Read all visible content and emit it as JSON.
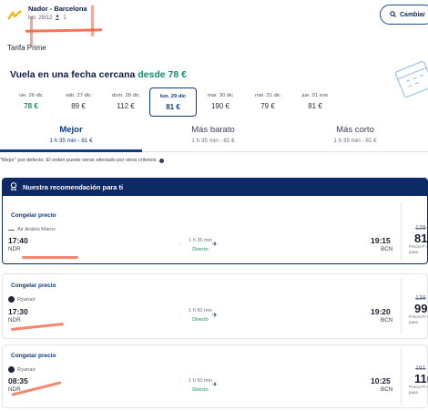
{
  "header": {
    "route": "Nador - Barcelona",
    "date": "lun. 29/12",
    "passengers": "1",
    "change_label": "Cambiar"
  },
  "fare": "Tarifa Prime",
  "nearby": {
    "title": "Vuela en una fecha cercana",
    "from_label": "desde 78 €",
    "dates": [
      {
        "day": "vie. 26 dic",
        "price": "78 €",
        "highlight": true,
        "selected": false
      },
      {
        "day": "sáb. 27 dic",
        "price": "89 €",
        "highlight": false,
        "selected": false
      },
      {
        "day": "dom. 28 dic",
        "price": "112 €",
        "highlight": false,
        "selected": false
      },
      {
        "day": "lun. 29 dic",
        "price": "81 €",
        "highlight": false,
        "selected": true
      },
      {
        "day": "mar. 30 dic",
        "price": "190 €",
        "highlight": false,
        "selected": false
      },
      {
        "day": "mié. 31 dic",
        "price": "79 €",
        "highlight": false,
        "selected": false
      },
      {
        "day": "jue. 01 ene",
        "price": "81 €",
        "highlight": false,
        "selected": false
      }
    ]
  },
  "tabs": [
    {
      "label": "Mejor",
      "sub": "1 h 35 min - 81 €"
    },
    {
      "label": "Más barato",
      "sub": "1 h 35 min - 81 €"
    },
    {
      "label": "Más corto",
      "sub": "1 h 35 min - 81 €"
    }
  ],
  "note": "\"Mejor\" por defecto. El orden puede verse afectado por otros criterios",
  "recommendation_title": "Nuestra recomendación para ti",
  "flights": [
    {
      "freeze": "Congelar precio",
      "airline": "Air Arabia Maroc",
      "dep_time": "17:40",
      "dep_code": "NDR",
      "duration": "1 h 35 min",
      "direct": "Directo",
      "arr_time": "19:15",
      "arr_code": "BCN",
      "old_price": "129",
      "price": "81",
      "price_note": "Precio P / por pasa"
    },
    {
      "freeze": "Congelar precio",
      "airline": "Ryanair",
      "dep_time": "17:30",
      "dep_code": "NDR",
      "duration": "1 h 50 min",
      "direct": "Directo",
      "arr_time": "19:20",
      "arr_code": "BCN",
      "old_price": "139",
      "price": "99",
      "price_note": "Precio Pr / por pasa"
    },
    {
      "freeze": "Congelar precio",
      "airline": "Ryanair",
      "dep_time": "08:35",
      "dep_code": "NDR",
      "duration": "1 h 50 min",
      "direct": "Directo",
      "arr_time": "10:25",
      "arr_code": "BCN",
      "old_price": "161",
      "price": "116",
      "price_note": "Precio Pr / por pasa"
    }
  ],
  "colors": {
    "navy": "#0d2a66",
    "green": "#1a8a6a",
    "accent": "#0d3a80",
    "redact": "#f25c3b"
  }
}
